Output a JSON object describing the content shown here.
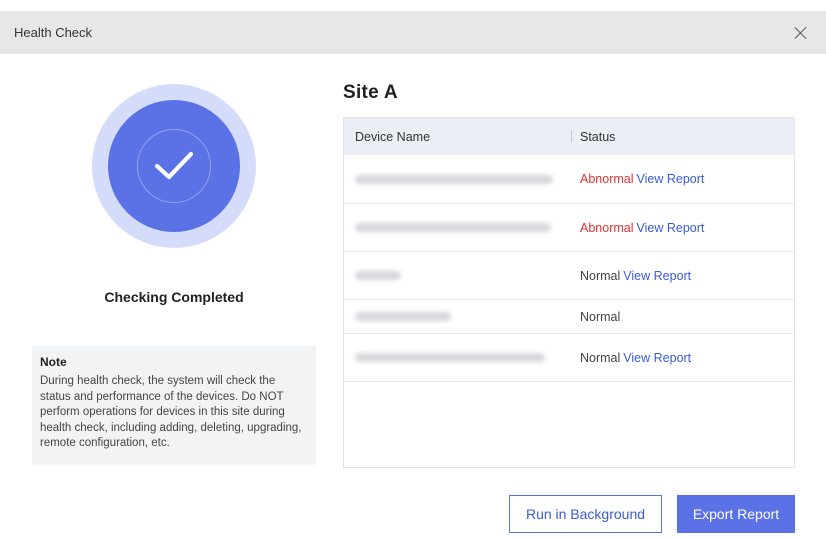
{
  "dialog": {
    "title": "Health Check"
  },
  "status": {
    "text": "Checking Completed",
    "icon": "checkmark-icon",
    "colors": {
      "ring": "#d4dcfa",
      "disc": "#5b72e6"
    }
  },
  "note": {
    "title": "Note",
    "body": "During health check, the system will check the status and performance of the devices. Do NOT perform operations for devices in this site during health check, including adding, deleting, upgrading, remote configuration, etc."
  },
  "site": {
    "name": "Site A"
  },
  "table": {
    "headers": {
      "device_name": "Device Name",
      "status": "Status"
    },
    "rows": [
      {
        "status": "Abnormal",
        "status_kind": "abnormal",
        "link": "View Report"
      },
      {
        "status": "Abnormal",
        "status_kind": "abnormal",
        "link": "View Report"
      },
      {
        "status": "Normal",
        "status_kind": "normal",
        "link": "View Report"
      },
      {
        "status": "Normal",
        "status_kind": "normal",
        "link": ""
      },
      {
        "status": "Normal",
        "status_kind": "normal",
        "link": "View Report"
      }
    ]
  },
  "buttons": {
    "run_background": "Run in Background",
    "export_report": "Export Report"
  },
  "colors": {
    "accent": "#5b72e6",
    "link": "#3a5bd9",
    "abnormal": "#e03131"
  }
}
